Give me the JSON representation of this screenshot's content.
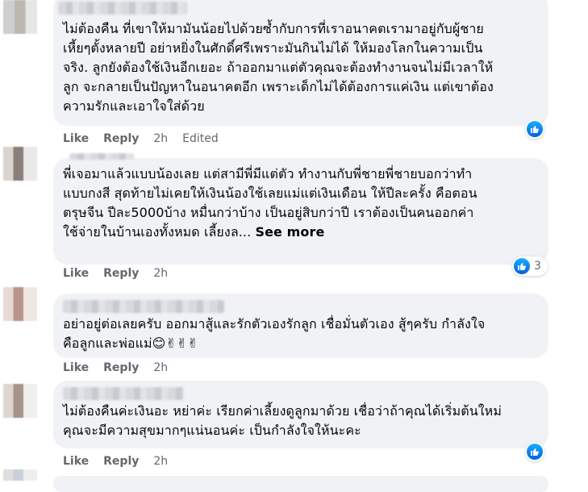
{
  "comments": [
    {
      "text": "ไม่ต้องคืน ที่เขาให้มามันน้อยไปด้วยซ้ำกับการที่เราอนาคตเรามาอยู่กับผู้ชาย\nเหี้ยๆตั้งหลายปี อย่าหยิ่งในศักดิ์ศรีเพราะมันกินไม่ได้ ให้มองโลกในความเป็น\nจริง. ลูกยังต้องใช้เงินอีกเยอะ ถ้าออกมาแต่ตัวคุณจะต้องทำงานจนไม่มีเวลาให้\nลูก จะกลายเป็นปัญหาในอนาคตอีก เพราะเด็กไม่ได้ต้องการแค่เงิน แต่เขาต้อง\nความรักและเอาใจใส่ด้วย",
      "like": "Like",
      "reply": "Reply",
      "time": "2h",
      "edited": "Edited",
      "reaction": "like-icon",
      "reaction_count": ""
    },
    {
      "text": "พี่เจอมาแล้วแบบน้องเลย แต่สามีพี่มีแต่ตัว ทำงานกับพี่ชายพี่ชายบอกว่าทำ\nแบบกงสี สุดท้ายไม่เคยให้เงินน้องใช้เลยแม่แต่เงินเดือน ให้ปีละครั้ง คือตอน\nตรุษจีน ปีละ5000บ้าง หมื่นกว่าบ้าง เป็นอยู่สิบกว่าปี เราต้องเป็นคนออกค่า\nใช้จ่ายในบ้านเองทั้งหมด เลี้ยงล...",
      "see_more": "See more",
      "like": "Like",
      "reply": "Reply",
      "time": "2h",
      "edited": "",
      "reaction": "like-icon",
      "reaction_count": "3"
    },
    {
      "text": "อย่าอยู่ต่อเลยครับ ออกมาสู้และรักตัวเองรักลูก เชื่อมั่นตัวเอง สู้ๆครับ กำลังใจ\nคือลูกและพ่อแม่",
      "emojis": "😊✌✌✌",
      "like": "Like",
      "reply": "Reply",
      "time": "2h",
      "edited": "",
      "reaction": "",
      "reaction_count": ""
    },
    {
      "text": "ไม่ต้องคืนค่ะเงินอะ หย่าค่ะ เรียกค่าเลี้ยงดูลูกมาด้วย เชื่อว่าถ้าคุณได้เริ่มต้นใหม่\nคุณจะมีความสุขมากๆแน่นอนค่ะ เป็นกำลังใจให้นะคะ",
      "like": "Like",
      "reply": "Reply",
      "time": "2h",
      "edited": "",
      "reaction": "like-icon",
      "reaction_count": ""
    }
  ],
  "colors": {
    "bubble": "#f0f2f5",
    "meta": "#65676b",
    "like_blue": "#1877f2"
  }
}
